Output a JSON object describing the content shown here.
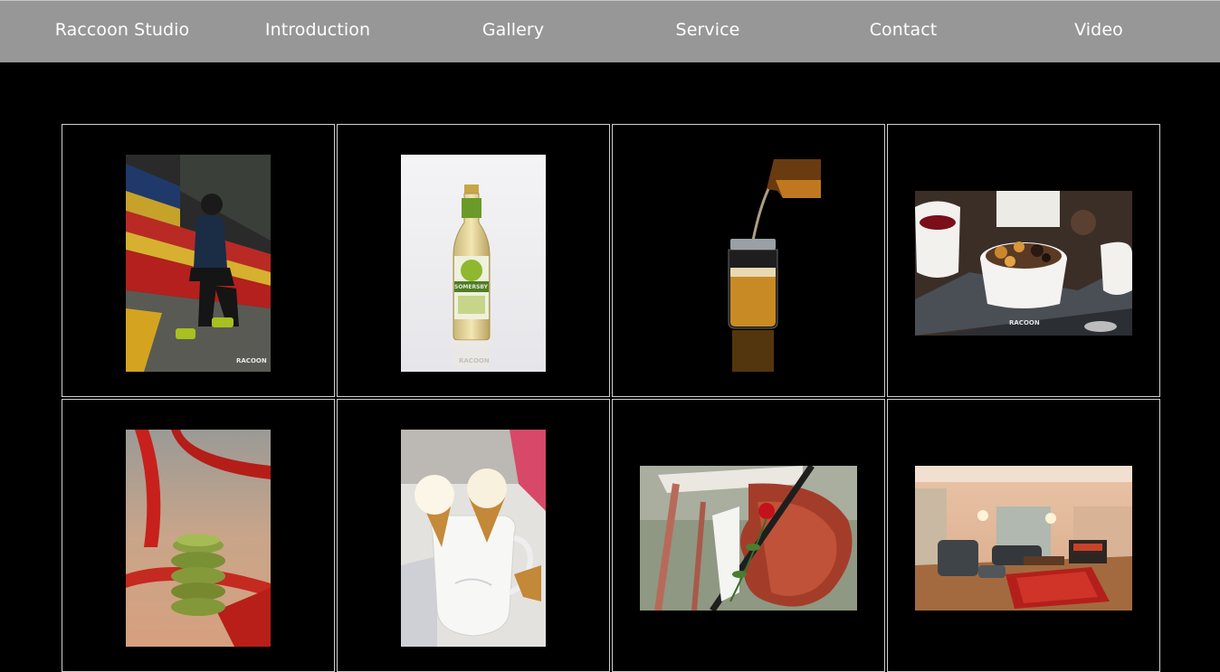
{
  "nav": {
    "items": [
      {
        "label": "Raccoon Studio"
      },
      {
        "label": "Introduction"
      },
      {
        "label": "Gallery"
      },
      {
        "label": "Service"
      },
      {
        "label": "Contact"
      },
      {
        "label": "Video"
      }
    ]
  },
  "colors": {
    "navbar_bg": "#979797",
    "page_bg": "#000000",
    "cell_border": "#cfcfcf"
  },
  "gallery": {
    "photos": [
      {
        "subject": "person-on-stadium-steps",
        "watermark": "RACOON"
      },
      {
        "subject": "somersby-cider-bottle",
        "label": "SOMERSBY",
        "watermark": "RACOON"
      },
      {
        "subject": "pouring-drink-into-jar"
      },
      {
        "subject": "dessert-ramekin",
        "watermark": "RACOON"
      },
      {
        "subject": "stacked-green-cookies"
      },
      {
        "subject": "ice-cream-cones-in-pitcher"
      },
      {
        "subject": "violin-with-rose"
      },
      {
        "subject": "hotel-lounge-room"
      }
    ]
  }
}
